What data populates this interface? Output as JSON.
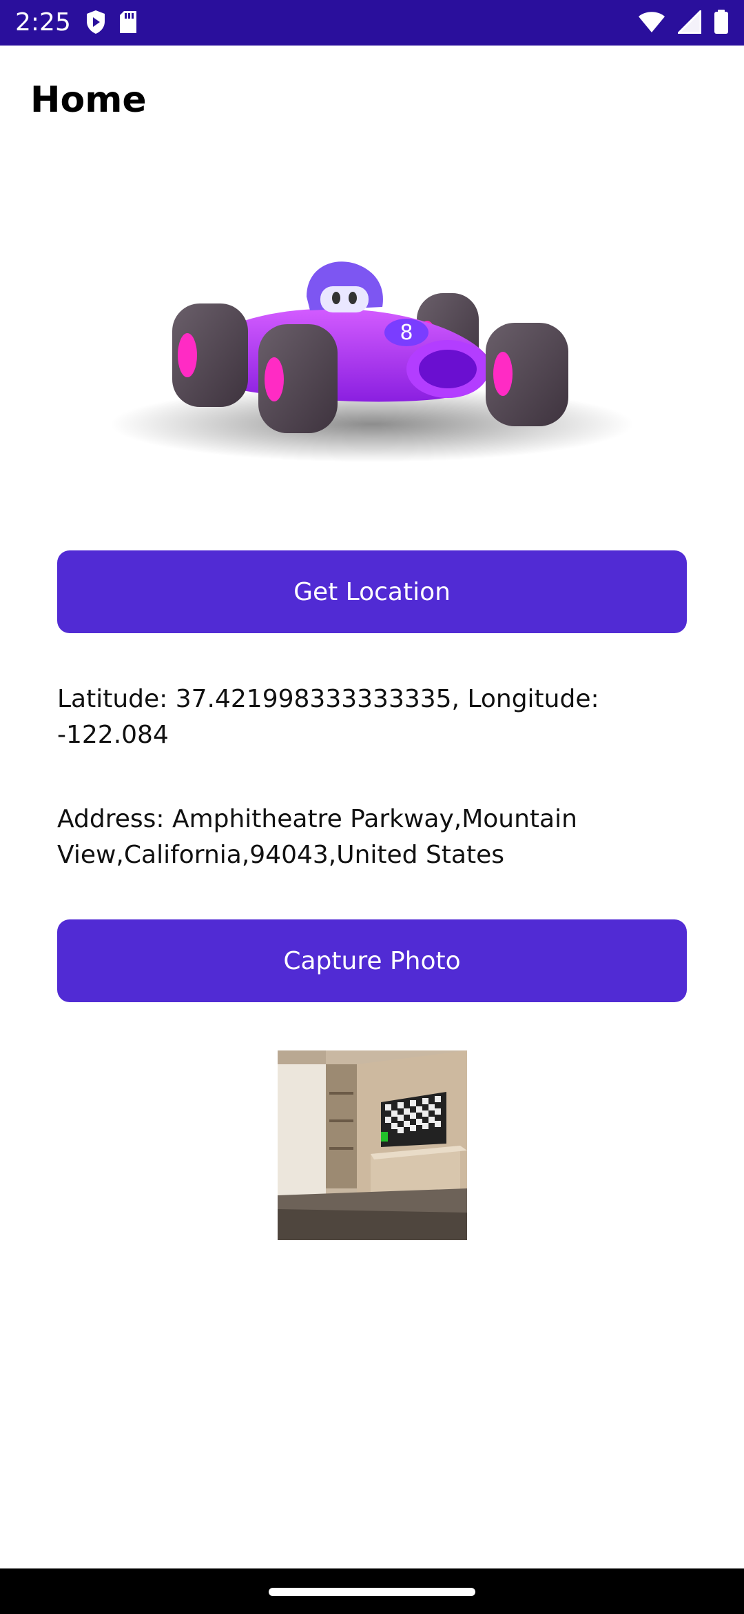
{
  "status_bar": {
    "time": "2:25",
    "left_icons": [
      "shield-play-icon",
      "sd-card-icon"
    ],
    "right_icons": [
      "wifi-icon",
      "signal-icon",
      "battery-icon"
    ],
    "background": "#2a0f9c"
  },
  "header": {
    "title": "Home"
  },
  "hero": {
    "icon": "race-car-bot-icon"
  },
  "location": {
    "button_label": "Get Location",
    "coordinates_text": "Latitude: 37.421998333333335, Longitude: -122.084",
    "address_text": "Address: Amphitheatre Parkway,Mountain View,California,94043,United States"
  },
  "photo": {
    "button_label": "Capture Photo",
    "thumbnail_icon": "captured-room-photo"
  },
  "colors": {
    "accent": "#512bd4",
    "status_bar": "#2a0f9c"
  }
}
